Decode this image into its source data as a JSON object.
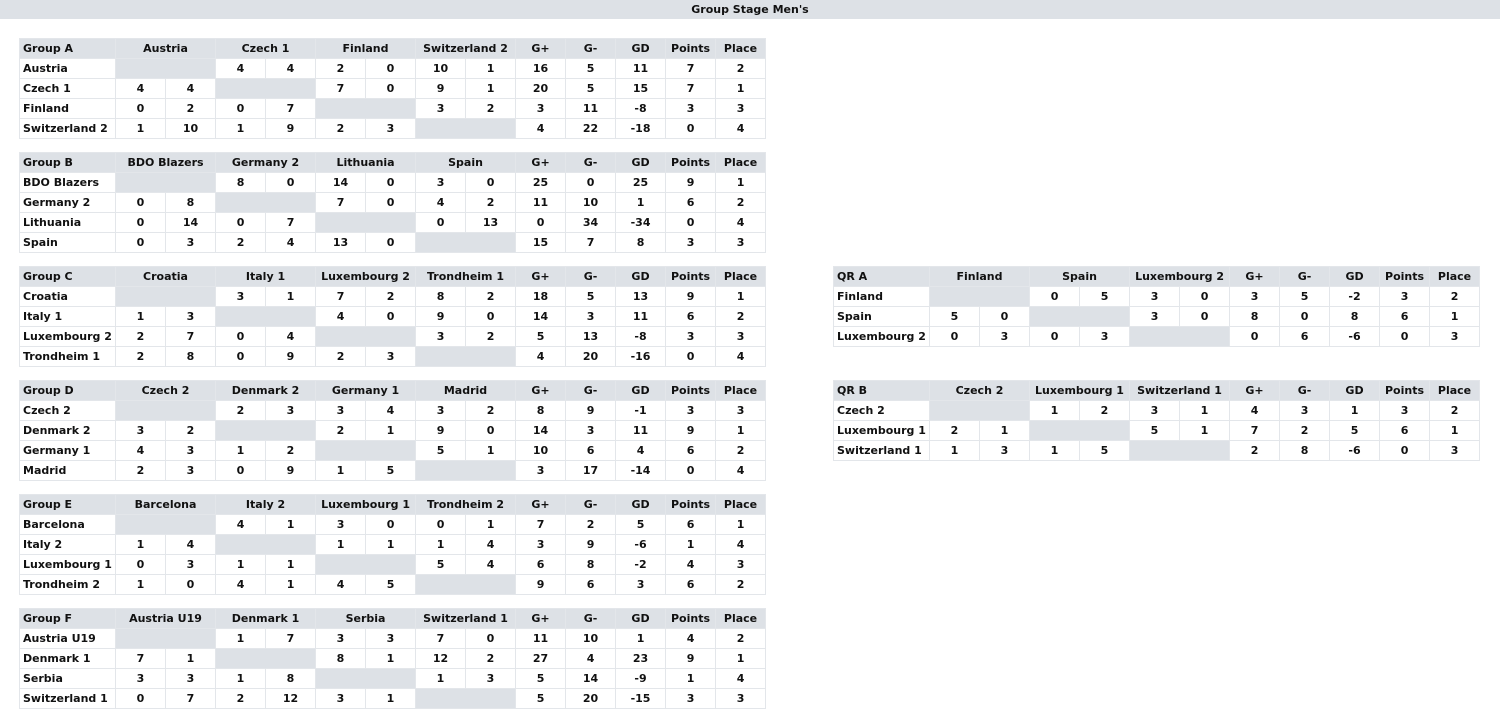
{
  "page_title": "Group Stage Men's",
  "colors": {
    "header_bg": "#dde1e6",
    "grid_line": "#e3e6ea"
  },
  "stat_headers": [
    "G+",
    "G-",
    "GD",
    "Points",
    "Place"
  ],
  "groups": [
    {
      "name": "Group A",
      "teams": [
        "Austria",
        "Czech 1",
        "Finland",
        "Switzerland 2"
      ],
      "rows": [
        {
          "team": "Austria",
          "scores": [
            null,
            [
              "4",
              "4"
            ],
            [
              "2",
              "0"
            ],
            [
              "10",
              "1"
            ]
          ],
          "stats": [
            "16",
            "5",
            "11",
            "7",
            "2"
          ]
        },
        {
          "team": "Czech 1",
          "scores": [
            [
              "4",
              "4"
            ],
            null,
            [
              "7",
              "0"
            ],
            [
              "9",
              "1"
            ]
          ],
          "stats": [
            "20",
            "5",
            "15",
            "7",
            "1"
          ]
        },
        {
          "team": "Finland",
          "scores": [
            [
              "0",
              "2"
            ],
            [
              "0",
              "7"
            ],
            null,
            [
              "3",
              "2"
            ]
          ],
          "stats": [
            "3",
            "11",
            "-8",
            "3",
            "3"
          ]
        },
        {
          "team": "Switzerland 2",
          "scores": [
            [
              "1",
              "10"
            ],
            [
              "1",
              "9"
            ],
            [
              "2",
              "3"
            ],
            null
          ],
          "stats": [
            "4",
            "22",
            "-18",
            "0",
            "4"
          ]
        }
      ]
    },
    {
      "name": "Group B",
      "teams": [
        "BDO Blazers",
        "Germany 2",
        "Lithuania",
        "Spain"
      ],
      "rows": [
        {
          "team": "BDO Blazers",
          "scores": [
            null,
            [
              "8",
              "0"
            ],
            [
              "14",
              "0"
            ],
            [
              "3",
              "0"
            ]
          ],
          "stats": [
            "25",
            "0",
            "25",
            "9",
            "1"
          ]
        },
        {
          "team": "Germany 2",
          "scores": [
            [
              "0",
              "8"
            ],
            null,
            [
              "7",
              "0"
            ],
            [
              "4",
              "2"
            ]
          ],
          "stats": [
            "11",
            "10",
            "1",
            "6",
            "2"
          ]
        },
        {
          "team": "Lithuania",
          "scores": [
            [
              "0",
              "14"
            ],
            [
              "0",
              "7"
            ],
            null,
            [
              "0",
              "13"
            ]
          ],
          "stats": [
            "0",
            "34",
            "-34",
            "0",
            "4"
          ]
        },
        {
          "team": "Spain",
          "scores": [
            [
              "0",
              "3"
            ],
            [
              "2",
              "4"
            ],
            [
              "13",
              "0"
            ],
            null
          ],
          "stats": [
            "15",
            "7",
            "8",
            "3",
            "3"
          ]
        }
      ]
    },
    {
      "name": "Group C",
      "teams": [
        "Croatia",
        "Italy 1",
        "Luxembourg 2",
        "Trondheim 1"
      ],
      "rows": [
        {
          "team": "Croatia",
          "scores": [
            null,
            [
              "3",
              "1"
            ],
            [
              "7",
              "2"
            ],
            [
              "8",
              "2"
            ]
          ],
          "stats": [
            "18",
            "5",
            "13",
            "9",
            "1"
          ]
        },
        {
          "team": "Italy 1",
          "scores": [
            [
              "1",
              "3"
            ],
            null,
            [
              "4",
              "0"
            ],
            [
              "9",
              "0"
            ]
          ],
          "stats": [
            "14",
            "3",
            "11",
            "6",
            "2"
          ]
        },
        {
          "team": "Luxembourg 2",
          "scores": [
            [
              "2",
              "7"
            ],
            [
              "0",
              "4"
            ],
            null,
            [
              "3",
              "2"
            ]
          ],
          "stats": [
            "5",
            "13",
            "-8",
            "3",
            "3"
          ]
        },
        {
          "team": "Trondheim 1",
          "scores": [
            [
              "2",
              "8"
            ],
            [
              "0",
              "9"
            ],
            [
              "2",
              "3"
            ],
            null
          ],
          "stats": [
            "4",
            "20",
            "-16",
            "0",
            "4"
          ]
        }
      ]
    },
    {
      "name": "Group D",
      "teams": [
        "Czech 2",
        "Denmark 2",
        "Germany 1",
        "Madrid"
      ],
      "rows": [
        {
          "team": "Czech 2",
          "scores": [
            null,
            [
              "2",
              "3"
            ],
            [
              "3",
              "4"
            ],
            [
              "3",
              "2"
            ]
          ],
          "stats": [
            "8",
            "9",
            "-1",
            "3",
            "3"
          ]
        },
        {
          "team": "Denmark 2",
          "scores": [
            [
              "3",
              "2"
            ],
            null,
            [
              "2",
              "1"
            ],
            [
              "9",
              "0"
            ]
          ],
          "stats": [
            "14",
            "3",
            "11",
            "9",
            "1"
          ]
        },
        {
          "team": "Germany 1",
          "scores": [
            [
              "4",
              "3"
            ],
            [
              "1",
              "2"
            ],
            null,
            [
              "5",
              "1"
            ]
          ],
          "stats": [
            "10",
            "6",
            "4",
            "6",
            "2"
          ]
        },
        {
          "team": "Madrid",
          "scores": [
            [
              "2",
              "3"
            ],
            [
              "0",
              "9"
            ],
            [
              "1",
              "5"
            ],
            null
          ],
          "stats": [
            "3",
            "17",
            "-14",
            "0",
            "4"
          ]
        }
      ]
    },
    {
      "name": "Group E",
      "teams": [
        "Barcelona",
        "Italy 2",
        "Luxembourg 1",
        "Trondheim 2"
      ],
      "rows": [
        {
          "team": "Barcelona",
          "scores": [
            null,
            [
              "4",
              "1"
            ],
            [
              "3",
              "0"
            ],
            [
              "0",
              "1"
            ]
          ],
          "stats": [
            "7",
            "2",
            "5",
            "6",
            "1"
          ]
        },
        {
          "team": "Italy 2",
          "scores": [
            [
              "1",
              "4"
            ],
            null,
            [
              "1",
              "1"
            ],
            [
              "1",
              "4"
            ]
          ],
          "stats": [
            "3",
            "9",
            "-6",
            "1",
            "4"
          ]
        },
        {
          "team": "Luxembourg 1",
          "scores": [
            [
              "0",
              "3"
            ],
            [
              "1",
              "1"
            ],
            null,
            [
              "5",
              "4"
            ]
          ],
          "stats": [
            "6",
            "8",
            "-2",
            "4",
            "3"
          ]
        },
        {
          "team": "Trondheim 2",
          "scores": [
            [
              "1",
              "0"
            ],
            [
              "4",
              "1"
            ],
            [
              "4",
              "5"
            ],
            null
          ],
          "stats": [
            "9",
            "6",
            "3",
            "6",
            "2"
          ]
        }
      ]
    },
    {
      "name": "Group F",
      "teams": [
        "Austria U19",
        "Denmark 1",
        "Serbia",
        "Switzerland 1"
      ],
      "rows": [
        {
          "team": "Austria U19",
          "scores": [
            null,
            [
              "1",
              "7"
            ],
            [
              "3",
              "3"
            ],
            [
              "7",
              "0"
            ]
          ],
          "stats": [
            "11",
            "10",
            "1",
            "4",
            "2"
          ]
        },
        {
          "team": "Denmark 1",
          "scores": [
            [
              "7",
              "1"
            ],
            null,
            [
              "8",
              "1"
            ],
            [
              "12",
              "2"
            ]
          ],
          "stats": [
            "27",
            "4",
            "23",
            "9",
            "1"
          ]
        },
        {
          "team": "Serbia",
          "scores": [
            [
              "3",
              "3"
            ],
            [
              "1",
              "8"
            ],
            null,
            [
              "1",
              "3"
            ]
          ],
          "stats": [
            "5",
            "14",
            "-9",
            "1",
            "4"
          ]
        },
        {
          "team": "Switzerland 1",
          "scores": [
            [
              "0",
              "7"
            ],
            [
              "2",
              "12"
            ],
            [
              "3",
              "1"
            ],
            null
          ],
          "stats": [
            "5",
            "20",
            "-15",
            "3",
            "3"
          ]
        }
      ]
    },
    {
      "name": "QR A",
      "teams": [
        "Finland",
        "Spain",
        "Luxembourg 2"
      ],
      "rows": [
        {
          "team": "Finland",
          "scores": [
            null,
            [
              "0",
              "5"
            ],
            [
              "3",
              "0"
            ]
          ],
          "stats": [
            "3",
            "5",
            "-2",
            "3",
            "2"
          ]
        },
        {
          "team": "Spain",
          "scores": [
            [
              "5",
              "0"
            ],
            null,
            [
              "3",
              "0"
            ]
          ],
          "stats": [
            "8",
            "0",
            "8",
            "6",
            "1"
          ]
        },
        {
          "team": "Luxembourg 2",
          "scores": [
            [
              "0",
              "3"
            ],
            [
              "0",
              "3"
            ],
            null
          ],
          "stats": [
            "0",
            "6",
            "-6",
            "0",
            "3"
          ]
        }
      ]
    },
    {
      "name": "QR B",
      "teams": [
        "Czech 2",
        "Luxembourg 1",
        "Switzerland 1"
      ],
      "rows": [
        {
          "team": "Czech 2",
          "scores": [
            null,
            [
              "1",
              "2"
            ],
            [
              "3",
              "1"
            ]
          ],
          "stats": [
            "4",
            "3",
            "1",
            "3",
            "2"
          ]
        },
        {
          "team": "Luxembourg 1",
          "scores": [
            [
              "2",
              "1"
            ],
            null,
            [
              "5",
              "1"
            ]
          ],
          "stats": [
            "7",
            "2",
            "5",
            "6",
            "1"
          ]
        },
        {
          "team": "Switzerland 1",
          "scores": [
            [
              "1",
              "3"
            ],
            [
              "1",
              "5"
            ],
            null
          ],
          "stats": [
            "2",
            "8",
            "-6",
            "0",
            "3"
          ]
        }
      ]
    }
  ]
}
